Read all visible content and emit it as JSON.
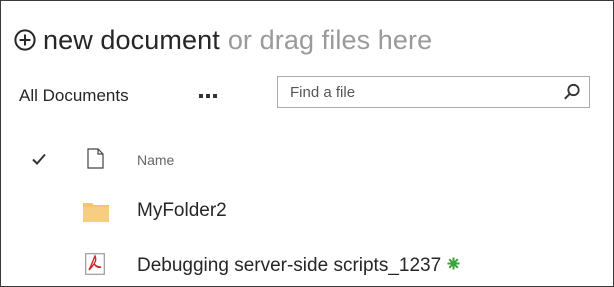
{
  "header": {
    "new_document_label": "new document",
    "drag_hint": "or drag files here",
    "plus_icon": "circle-plus-icon"
  },
  "toolbar": {
    "view_label": "All Documents",
    "more_label": "...",
    "search": {
      "placeholder": "Find a file",
      "value": "",
      "icon": "search-icon"
    }
  },
  "columns": {
    "select_icon": "checkmark-icon",
    "type_icon": "document-icon",
    "name_label": "Name"
  },
  "items": [
    {
      "name": "MyFolder2",
      "icon": "folder-icon",
      "is_new": false
    },
    {
      "name": "Debugging server-side scripts_1237",
      "icon": "pdf-icon",
      "is_new": true
    }
  ],
  "colors": {
    "folder": "#f5c471",
    "pdf_red": "#cc2a2a",
    "new_badge_green": "#3aa33a",
    "border": "#3a3a3a",
    "muted_text": "#9a9a9a"
  }
}
